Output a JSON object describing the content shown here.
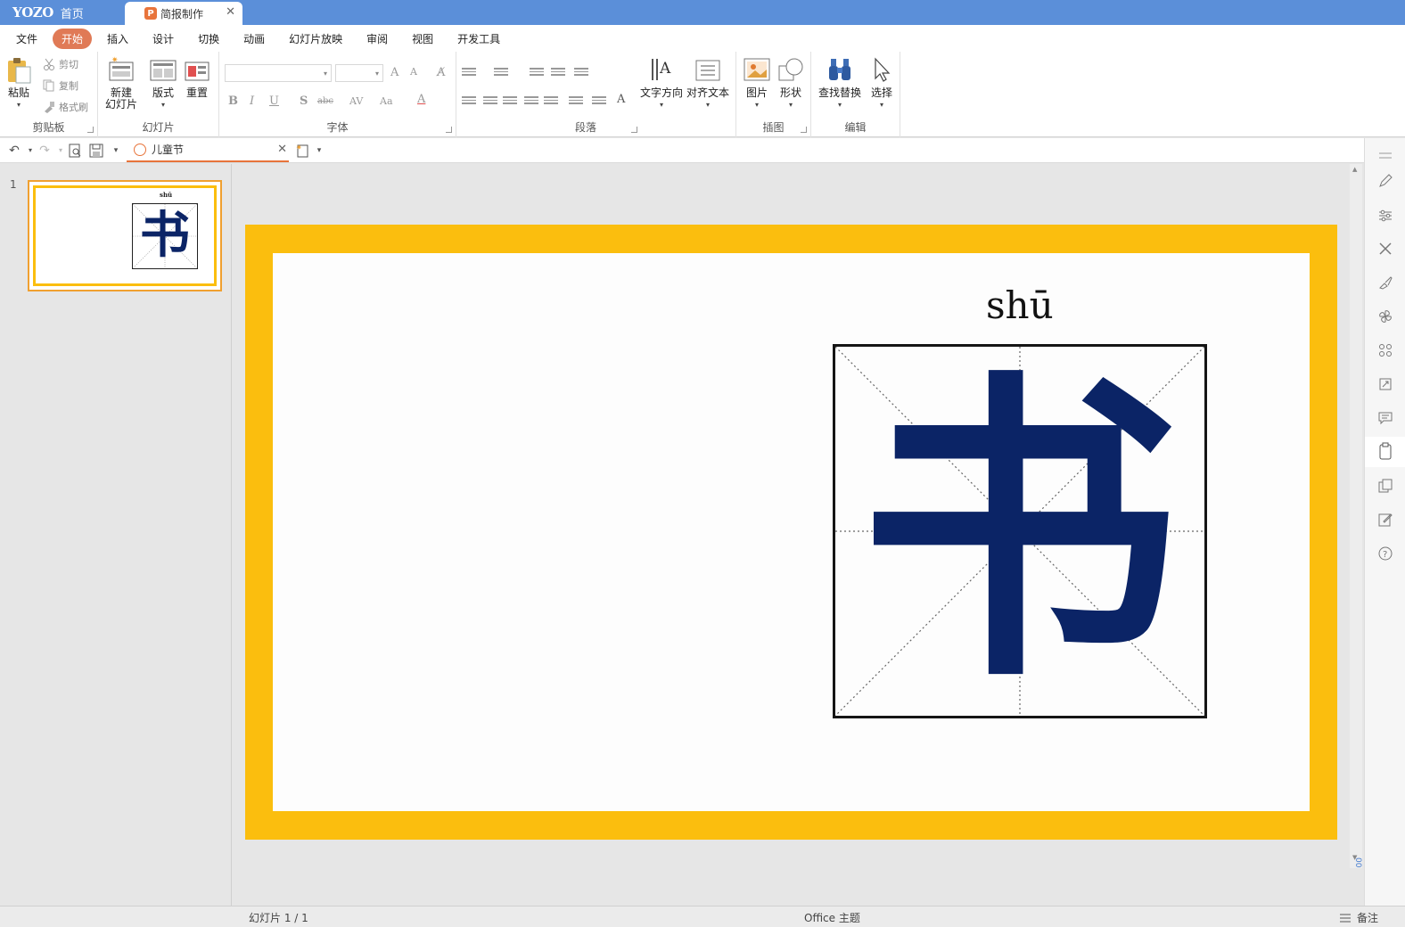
{
  "titlebar": {
    "logo": "YOZO",
    "home_label": "首页",
    "doc_tab_label": "简报制作",
    "doc_tab_icon": "P"
  },
  "menu": [
    "文件",
    "开始",
    "插入",
    "设计",
    "切换",
    "动画",
    "幻灯片放映",
    "审阅",
    "视图",
    "开发工具"
  ],
  "menu_active_index": 1,
  "ribbon": {
    "clipboard": {
      "paste": "粘贴",
      "cut": "剪切",
      "copy": "复制",
      "format_painter": "格式刷",
      "label": "剪贴板"
    },
    "slides": {
      "new_slide_line1": "新建",
      "new_slide_line2": "幻灯片",
      "layout": "版式",
      "reset": "重置",
      "label": "幻灯片"
    },
    "font": {
      "label": "字体",
      "bold": "B",
      "italic": "I",
      "underline": "U",
      "shadow": "S",
      "strike": "abc",
      "spacing": "AV",
      "case": "Aa",
      "color": "A",
      "grow": "A",
      "shrink": "A"
    },
    "paragraph": {
      "label": "段落"
    },
    "textdir": {
      "text_direction": "文字方向",
      "align_text": "对齐文本"
    },
    "insert": {
      "picture": "图片",
      "shape": "形状",
      "label": "插图"
    },
    "edit": {
      "find_replace": "查找替换",
      "select": "选择",
      "label": "编辑"
    }
  },
  "qat": {
    "file_tab_label": "儿童节"
  },
  "thumbnails": {
    "number": "1",
    "pinyin": "shū",
    "char": "书"
  },
  "slide": {
    "pinyin": "shū",
    "char": "书"
  },
  "zoom_indicator": "00",
  "status": {
    "slide_counter": "幻灯片 1 / 1",
    "theme": "Office 主题",
    "notes": "备注"
  },
  "colors": {
    "titlebar": "#5b8fd9",
    "accent": "#e8743b",
    "slide_border": "#fbbe0e",
    "char_color": "#0b2466"
  },
  "icons": {
    "rightbar": [
      "pencil-icon",
      "sliders-icon",
      "tools-icon",
      "brush-icon",
      "pinwheel-icon",
      "grid-icon",
      "crop-icon",
      "comment-icon",
      "clipboard-icon",
      "copy-icon",
      "edit-icon",
      "help-icon"
    ]
  }
}
